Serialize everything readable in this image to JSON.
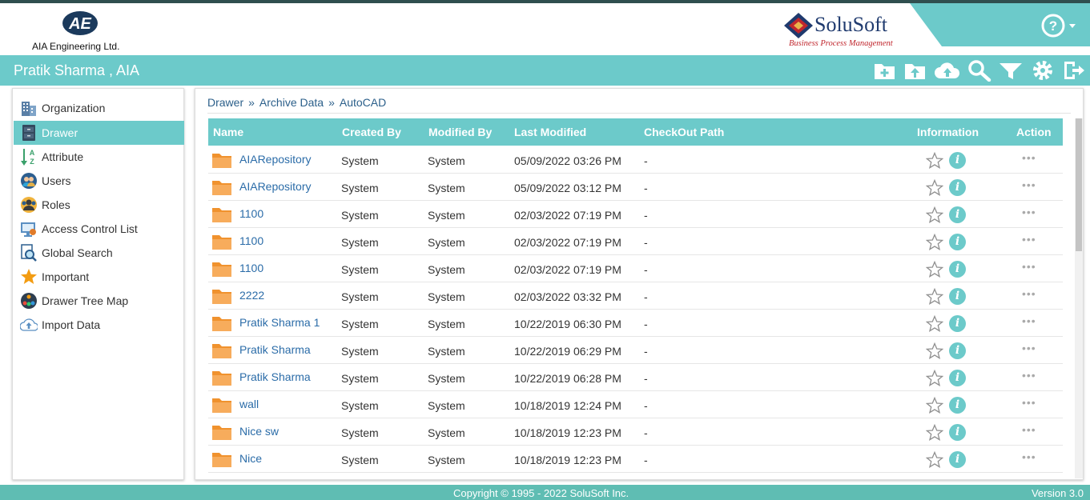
{
  "header": {
    "company_logo_text": "AIA Engineering Ltd.",
    "brand_name": "SoluSoft",
    "brand_tagline": "Business Process Management"
  },
  "titlebar": {
    "user": "Pratik Sharma , AIA",
    "actions": [
      "add-folder-icon",
      "upload-folder-icon",
      "cloud-upload-icon",
      "search-icon",
      "filter-icon",
      "settings-icon",
      "logout-icon"
    ]
  },
  "sidebar": {
    "items": [
      {
        "label": "Organization",
        "icon": "building-icon"
      },
      {
        "label": "Drawer",
        "icon": "drawer-icon",
        "active": true
      },
      {
        "label": "Attribute",
        "icon": "sort-az-icon"
      },
      {
        "label": "Users",
        "icon": "users-icon"
      },
      {
        "label": "Roles",
        "icon": "roles-icon"
      },
      {
        "label": "Access Control List",
        "icon": "access-control-icon"
      },
      {
        "label": "Global Search",
        "icon": "global-search-icon"
      },
      {
        "label": "Important",
        "icon": "star-icon"
      },
      {
        "label": "Drawer Tree Map",
        "icon": "tree-map-icon"
      },
      {
        "label": "Import Data",
        "icon": "cloud-import-icon"
      }
    ]
  },
  "breadcrumb": [
    "Drawer",
    "Archive Data",
    "AutoCAD"
  ],
  "table": {
    "columns": [
      "Name",
      "Created By",
      "Modified By",
      "Last Modified",
      "CheckOut Path",
      "Information",
      "Action"
    ],
    "rows": [
      {
        "name": "AIARepository",
        "created_by": "System",
        "modified_by": "System",
        "last_modified": "05/09/2022 03:26 PM",
        "checkout_path": "-"
      },
      {
        "name": "AIARepository",
        "created_by": "System",
        "modified_by": "System",
        "last_modified": "05/09/2022 03:12 PM",
        "checkout_path": "-"
      },
      {
        "name": "1100",
        "created_by": "System",
        "modified_by": "System",
        "last_modified": "02/03/2022 07:19 PM",
        "checkout_path": "-"
      },
      {
        "name": "1100",
        "created_by": "System",
        "modified_by": "System",
        "last_modified": "02/03/2022 07:19 PM",
        "checkout_path": "-"
      },
      {
        "name": "1100",
        "created_by": "System",
        "modified_by": "System",
        "last_modified": "02/03/2022 07:19 PM",
        "checkout_path": "-"
      },
      {
        "name": "2222",
        "created_by": "System",
        "modified_by": "System",
        "last_modified": "02/03/2022 03:32 PM",
        "checkout_path": "-"
      },
      {
        "name": "Pratik Sharma 1",
        "created_by": "System",
        "modified_by": "System",
        "last_modified": "10/22/2019 06:30 PM",
        "checkout_path": "-"
      },
      {
        "name": "Pratik Sharma",
        "created_by": "System",
        "modified_by": "System",
        "last_modified": "10/22/2019 06:29 PM",
        "checkout_path": "-"
      },
      {
        "name": "Pratik Sharma",
        "created_by": "System",
        "modified_by": "System",
        "last_modified": "10/22/2019 06:28 PM",
        "checkout_path": "-"
      },
      {
        "name": "wall",
        "created_by": "System",
        "modified_by": "System",
        "last_modified": "10/18/2019 12:24 PM",
        "checkout_path": "-"
      },
      {
        "name": "Nice sw",
        "created_by": "System",
        "modified_by": "System",
        "last_modified": "10/18/2019 12:23 PM",
        "checkout_path": "-"
      },
      {
        "name": "Nice",
        "created_by": "System",
        "modified_by": "System",
        "last_modified": "10/18/2019 12:23 PM",
        "checkout_path": "-"
      }
    ],
    "info_glyph": "i",
    "action_glyph": "•••"
  },
  "footer": {
    "copyright": "Copyright © 1995 - 2022 SoluSoft Inc.",
    "version": "Version 3.0"
  },
  "colors": {
    "teal": "#6ccaca",
    "footer_teal": "#5fbdb3",
    "link_blue": "#2b6ca8",
    "folder_orange": "#f5a04a",
    "brand_red": "#c0262d",
    "brand_navy": "#1f3a6e"
  }
}
